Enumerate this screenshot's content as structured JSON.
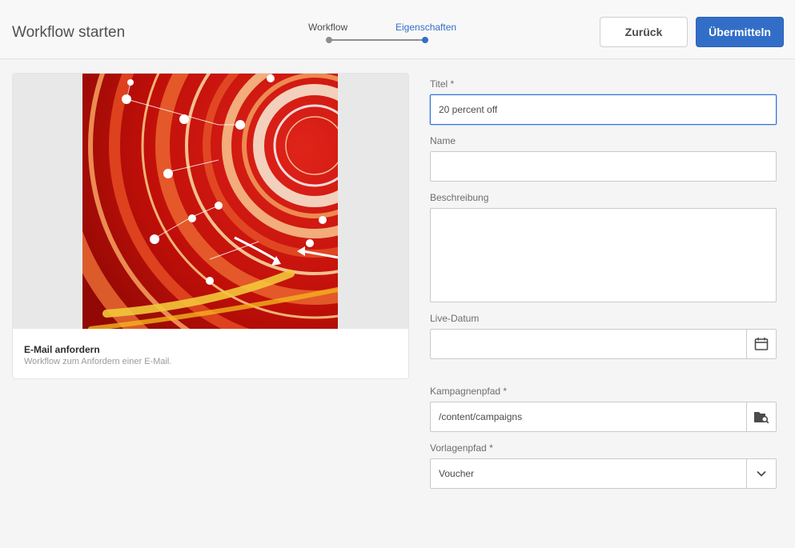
{
  "header": {
    "title": "Workflow starten",
    "back_label": "Zurück",
    "submit_label": "Übermitteln"
  },
  "wizard": {
    "steps": [
      {
        "label": "Workflow",
        "state": "done"
      },
      {
        "label": "Eigenschaften",
        "state": "active"
      }
    ]
  },
  "card": {
    "title": "E-Mail anfordern",
    "description": "Workflow zum Anfordern einer E-Mail."
  },
  "form": {
    "title_label": "Titel *",
    "title_value": "20 percent off",
    "name_label": "Name",
    "name_value": "",
    "description_label": "Beschreibung",
    "description_value": "",
    "live_date_label": "Live-Datum",
    "live_date_value": "",
    "campaign_path_label": "Kampagnenpfad *",
    "campaign_path_value": "/content/campaigns",
    "template_path_label": "Vorlagenpfad *",
    "template_path_value": "Voucher"
  },
  "icons": {
    "calendar": "calendar-icon",
    "folder_search": "folder-search-icon",
    "chevron": "chevron-down-icon"
  },
  "colors": {
    "accent": "#326ec8",
    "thumbnail_red": "#c4100a"
  }
}
